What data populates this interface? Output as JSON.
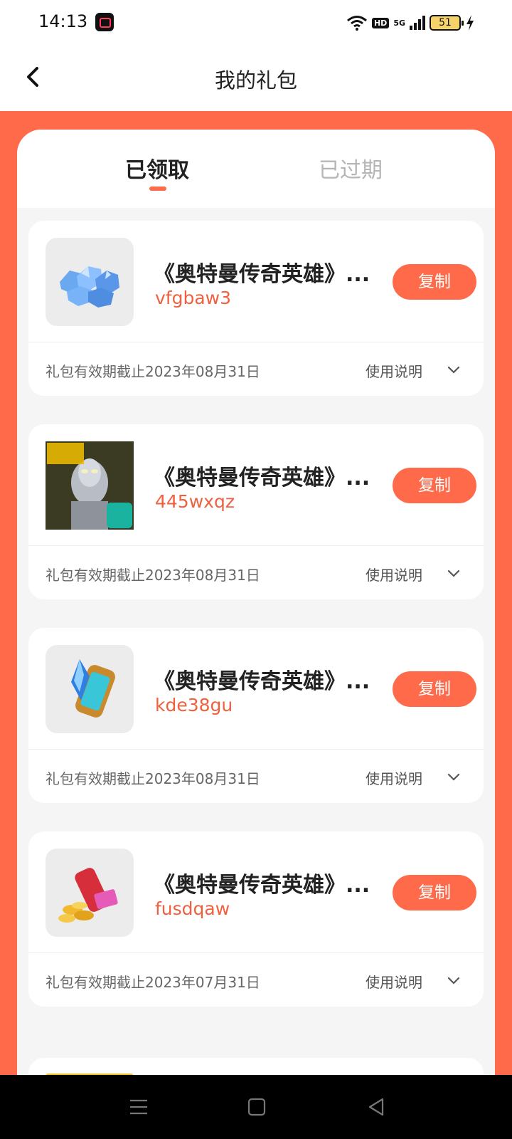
{
  "status_bar": {
    "time": "14:13",
    "network": "5G",
    "hd": "HD",
    "battery": "51"
  },
  "header": {
    "title": "我的礼包"
  },
  "tabs": [
    {
      "label": "已领取",
      "active": true
    },
    {
      "label": "已过期",
      "active": false
    }
  ],
  "gifts": [
    {
      "icon": "blue-crystals-icon",
      "title": "《奥特曼传奇英雄》...",
      "code": "vfgbaw3",
      "copy_label": "复制",
      "expiry": "礼包有效期截止2023年08月31日",
      "usage_label": "使用说明"
    },
    {
      "icon": "ultraman-legend-icon",
      "title": "《奥特曼传奇英雄》...",
      "code": "445wxqz",
      "copy_label": "复制",
      "expiry": "礼包有效期截止2023年08月31日",
      "usage_label": "使用说明"
    },
    {
      "icon": "energy-capsule-icon",
      "title": "《奥特曼传奇英雄》...",
      "code": "kde38gu",
      "copy_label": "复制",
      "expiry": "礼包有效期截止2023年08月31日",
      "usage_label": "使用说明"
    },
    {
      "icon": "gold-coins-icon",
      "title": "《奥特曼传奇英雄》...",
      "code": "fusdqaw",
      "copy_label": "复制",
      "expiry": "礼包有效期截止2023年07月31日",
      "usage_label": "使用说明"
    }
  ],
  "colors": {
    "accent": "#ff6b4a",
    "code_text": "#f0603f",
    "background": "#f5f5f5"
  }
}
